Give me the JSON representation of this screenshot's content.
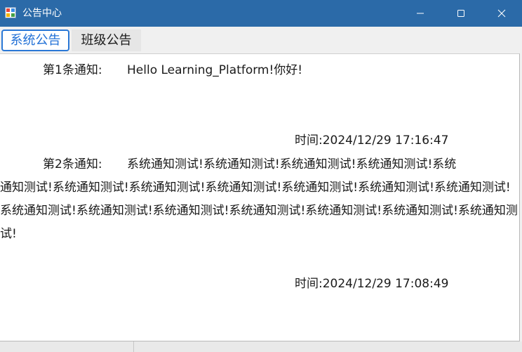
{
  "window": {
    "title": "公告中心",
    "titlebar_color": "#2b6aa8",
    "icons": {
      "app": "app-icon",
      "minimize": "minimize-icon",
      "maximize": "maximize-icon",
      "close": "close-icon"
    }
  },
  "tabs": [
    {
      "label": "系统公告",
      "active": true
    },
    {
      "label": "班级公告",
      "active": false
    }
  ],
  "notices": [
    {
      "label": "第1条通知:",
      "body_first": "Hello Learning_Platform!你好!",
      "body_rest": "",
      "time": "时间:2024/12/29 17:16:47"
    },
    {
      "label": "第2条通知:",
      "body_first": "系统通知测试!系统通知测试!系统通知测试!系统通知测试!系统",
      "body_rest": "通知测试!系统通知测试!系统通知测试!系统通知测试!系统通知测试!系统通知测试!系统通知测试!系统通知测试!系统通知测试!系统通知测试!系统通知测试!系统通知测试!系统通知测试!系统通知测试!",
      "time": "时间:2024/12/29 17:08:49"
    }
  ]
}
